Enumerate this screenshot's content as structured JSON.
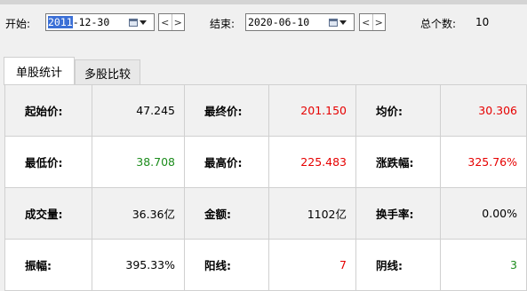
{
  "toolbar": {
    "start_label": "开始:",
    "start_year": "2011",
    "start_rest": "-12-30",
    "end_label": "结束:",
    "end_date": "2020-06-10",
    "prev_glyph": "<",
    "next_glyph": ">",
    "total_label": "总个数:",
    "total_value": "10"
  },
  "tabs": [
    {
      "label": "单股统计",
      "active": true
    },
    {
      "label": "多股比较",
      "active": false
    }
  ],
  "stats": {
    "rows": [
      [
        {
          "k": "起始价:",
          "v": "47.245",
          "c": "black"
        },
        {
          "k": "最终价:",
          "v": "201.150",
          "c": "red"
        },
        {
          "k": "均价:",
          "v": "30.306",
          "c": "red"
        }
      ],
      [
        {
          "k": "最低价:",
          "v": "38.708",
          "c": "green"
        },
        {
          "k": "最高价:",
          "v": "225.483",
          "c": "red"
        },
        {
          "k": "涨跌幅:",
          "v": "325.76%",
          "c": "red"
        }
      ],
      [
        {
          "k": "成交量:",
          "v": "36.36亿",
          "c": "black"
        },
        {
          "k": "金额:",
          "v": "1102亿",
          "c": "black"
        },
        {
          "k": "换手率:",
          "v": "0.00%",
          "c": "black"
        }
      ],
      [
        {
          "k": "振幅:",
          "v": "395.33%",
          "c": "black"
        },
        {
          "k": "阳线:",
          "v": "7",
          "c": "red"
        },
        {
          "k": "阴线:",
          "v": "3",
          "c": "green"
        }
      ]
    ]
  },
  "colors": {
    "red": "#e60000",
    "green": "#1c8c1c",
    "selection": "#3b6fd6"
  }
}
